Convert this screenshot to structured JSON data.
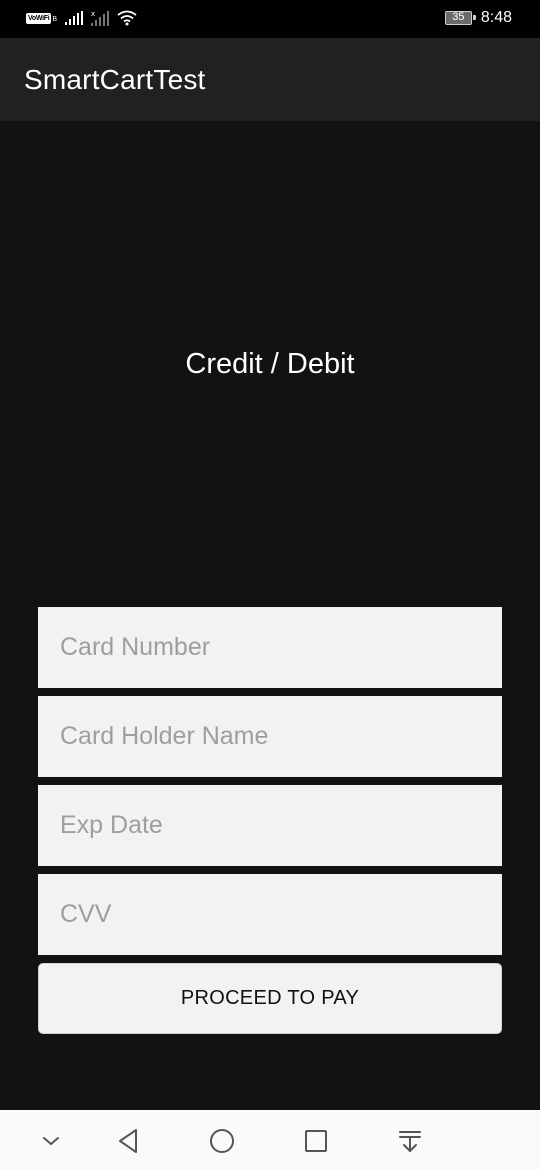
{
  "status_bar": {
    "network_badge": "VoWiFi",
    "sim_indicator": "B",
    "battery_level": "35",
    "time": "8:48"
  },
  "app_bar": {
    "title": "SmartCartTest"
  },
  "payment": {
    "heading": "Credit / Debit",
    "fields": {
      "card_number_placeholder": "Card Number",
      "card_holder_placeholder": "Card Holder Name",
      "exp_date_placeholder": "Exp Date",
      "cvv_placeholder": "CVV"
    },
    "proceed_label": "PROCEED TO PAY"
  },
  "nav_bar": {
    "icons": [
      "chevron-down-icon",
      "back-icon",
      "home-icon",
      "recents-icon",
      "notification-pull-icon"
    ]
  },
  "colors": {
    "background": "#121212",
    "app_bar": "#212121",
    "field_bg": "#f2f2f2",
    "placeholder": "#9e9e9e"
  }
}
